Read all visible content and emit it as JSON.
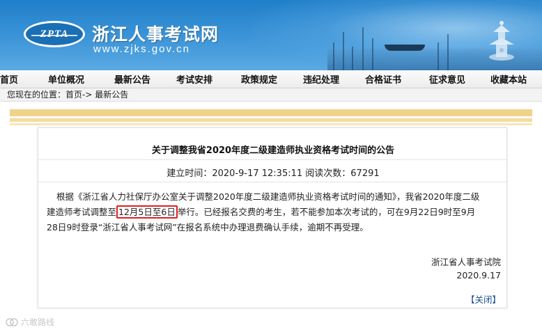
{
  "header": {
    "logo_text": "ZPTA",
    "site_title": "浙江人事考试网",
    "site_url": "www.zjks.gov.cn"
  },
  "nav": {
    "items": [
      {
        "label": "首页"
      },
      {
        "label": "单位概况"
      },
      {
        "label": "最新公告"
      },
      {
        "label": "考试安排"
      },
      {
        "label": "政策规定"
      },
      {
        "label": "违纪处理"
      },
      {
        "label": "合格证书"
      },
      {
        "label": "征求意见"
      },
      {
        "label": "收藏本站"
      }
    ]
  },
  "breadcrumb": {
    "prefix": "您现在的位置：",
    "home": "首页",
    "separator": "->",
    "current": "最新公告"
  },
  "article": {
    "title": "关于调整我省2020年度二级建造师执业资格考试时间的公告",
    "meta": "建立时间：2020-9-17 12:35:11 阅读次数：67291",
    "body_line1": "根据《浙江省人力社保厅办公室关于调整2020年度二级建造师执业资格考试时间的通知》，我省2020年度二级",
    "body_line2_pre": "建造师考试调整至",
    "body_line2_highlight": "12月5日至6日",
    "body_line2_post": "举行。已经报名交费的考生，若不能参加本次考试的，可在9月22日9时至9月",
    "body_line3": "28日9时登录“浙江省人事考试网”在报名系统中办理退费确认手续，逾期不再受理。",
    "signature": "浙江省人事考试院",
    "date": "2020.9.17",
    "close_label": "【关闭】"
  },
  "watermark": {
    "text": "六敢路线"
  },
  "colors": {
    "header_blue": "#1f7fc9",
    "highlight_red": "#e02020",
    "stripe_gold": "#f2d28a",
    "link_blue": "#1d4f91"
  }
}
